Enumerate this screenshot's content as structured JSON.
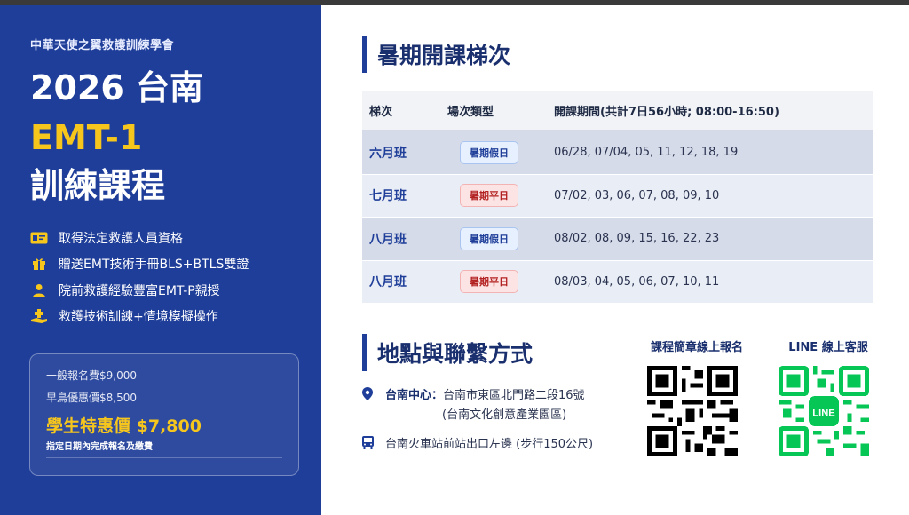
{
  "left": {
    "org": "中華天使之翼救護訓練學會",
    "title_line1": "2026 台南",
    "title_line2": "EMT-1",
    "title_line3": "訓練課程",
    "features": [
      {
        "icon": "id-card-icon",
        "text": "取得法定救護人員資格"
      },
      {
        "icon": "gift-icon",
        "text": "贈送EMT技術手冊BLS+BTLS雙證"
      },
      {
        "icon": "instructor-icon",
        "text": "院前救護經驗豐富EMT-P親授"
      },
      {
        "icon": "rescue-icon",
        "text": "救護技術訓練+情境模擬操作"
      }
    ],
    "prices": {
      "general": "一般報名費$9,000",
      "early": "早鳥優惠價$8,500",
      "student": "學生特惠價 $7,800",
      "note": "指定日期內完成報名及繳費"
    }
  },
  "schedule": {
    "title": "暑期開課梯次",
    "headers": [
      "梯次",
      "場次類型",
      "開課期間(共計7日56小時; 08:00-16:50)"
    ],
    "rows": [
      {
        "class": "六月班",
        "type": "暑期假日",
        "kind": "holiday",
        "dates": "06/28, 07/04, 05, 11, 12, 18, 19"
      },
      {
        "class": "七月班",
        "type": "暑期平日",
        "kind": "weekday",
        "dates": "07/02, 03, 06, 07, 08, 09, 10"
      },
      {
        "class": "八月班",
        "type": "暑期假日",
        "kind": "holiday",
        "dates": "08/02, 08, 09, 15, 16, 22, 23"
      },
      {
        "class": "八月班",
        "type": "暑期平日",
        "kind": "weekday",
        "dates": "08/03, 04, 05, 06, 07, 10, 11"
      }
    ]
  },
  "contact": {
    "title": "地點與聯繫方式",
    "venue_label": "台南中心：",
    "venue_address": "台南市東區北門路二段16號",
    "venue_sub": "(台南文化創意產業園區)",
    "transit": "台南火車站前站出口左邊 (步行150公尺)",
    "qr_register_label": "課程簡章線上報名",
    "qr_line_label": "LINE 線上客服",
    "line_logo_text": "LINE"
  },
  "colors": {
    "brand": "#1f3e99",
    "accent": "#f6c61d",
    "line_green": "#06c755"
  }
}
